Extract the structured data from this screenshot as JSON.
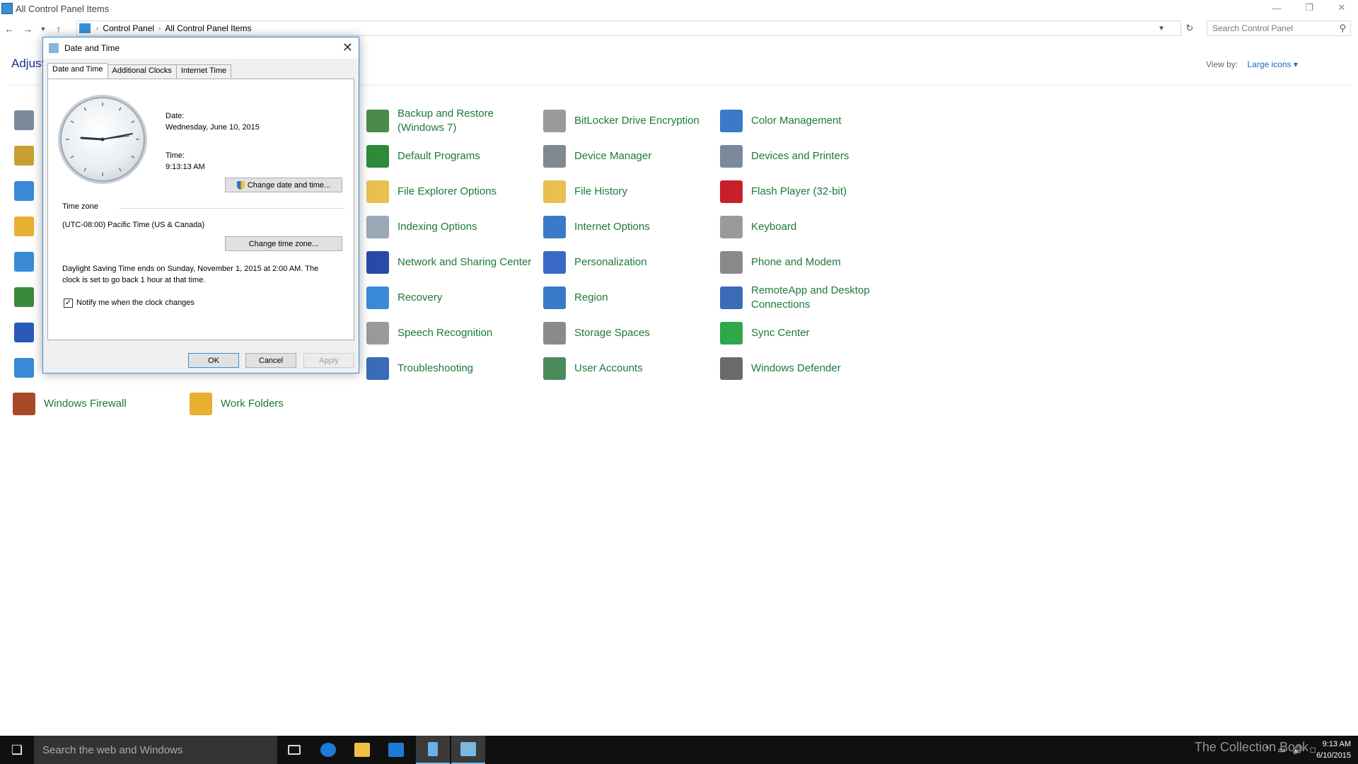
{
  "window": {
    "title": "All Control Panel Items"
  },
  "address": {
    "crumbs": [
      "Control Panel",
      "All Control Panel Items"
    ],
    "search_placeholder": "Search Control Panel"
  },
  "header": {
    "adjust_partial": "Adjust",
    "view_by_label": "View by:",
    "view_by_value": "Large icons"
  },
  "items": [
    {
      "label": "Backup and Restore (Windows 7)",
      "color": "#4a8a4a"
    },
    {
      "label": "BitLocker Drive Encryption",
      "color": "#9a9a9a"
    },
    {
      "label": "Color Management",
      "color": "#3a7ac8"
    },
    {
      "label": "Default Programs",
      "color": "#2c8a3a"
    },
    {
      "label": "Device Manager",
      "color": "#808890"
    },
    {
      "label": "Devices and Printers",
      "color": "#7a8a9a"
    },
    {
      "label": "File Explorer Options",
      "color": "#e8c050"
    },
    {
      "label": "File History",
      "color": "#e8c050"
    },
    {
      "label": "Flash Player (32-bit)",
      "color": "#c8202a"
    },
    {
      "label": "Indexing Options",
      "color": "#9aa8b8"
    },
    {
      "label": "Internet Options",
      "color": "#3a7ac8"
    },
    {
      "label": "Keyboard",
      "color": "#9a9a9a"
    },
    {
      "label": "Network and Sharing Center",
      "color": "#2a4aa8"
    },
    {
      "label": "Personalization",
      "color": "#3a6ac8"
    },
    {
      "label": "Phone and Modem",
      "color": "#8a8a8a"
    },
    {
      "label": "Recovery",
      "color": "#3a8ad8"
    },
    {
      "label": "Region",
      "color": "#3a7ac8"
    },
    {
      "label": "RemoteApp and Desktop Connections",
      "color": "#3a6ab8"
    },
    {
      "label": "Speech Recognition",
      "color": "#9a9a9a"
    },
    {
      "label": "Storage Spaces",
      "color": "#8a8a8a"
    },
    {
      "label": "Sync Center",
      "color": "#2ea84a"
    },
    {
      "label": "Troubleshooting",
      "color": "#3a6ab8"
    },
    {
      "label": "User Accounts",
      "color": "#4a8a5a"
    },
    {
      "label": "Windows Defender",
      "color": "#6a6a6a"
    },
    {
      "label": "Windows Firewall",
      "color": "#a84a2a"
    },
    {
      "label": "Work Folders",
      "color": "#e8b030"
    }
  ],
  "left_icons": [
    "#7a8a9a",
    "#c8a030",
    "#3a8ad8",
    "#e8b030",
    "#3a8ad8",
    "#3a8a3a",
    "#2a5ab8",
    "#3a8ad8"
  ],
  "dialog": {
    "title": "Date and Time",
    "tabs": [
      "Date and Time",
      "Additional Clocks",
      "Internet Time"
    ],
    "date_label": "Date:",
    "date_value": "Wednesday, June 10, 2015",
    "time_label": "Time:",
    "time_value": "9:13:13 AM",
    "change_datetime": "Change date and time...",
    "timezone_label": "Time zone",
    "timezone_value": "(UTC-08:00) Pacific Time (US & Canada)",
    "change_timezone": "Change time zone...",
    "dst_line1": "Daylight Saving Time ends on Sunday, November 1, 2015 at 2:00 AM. The",
    "dst_line2": "clock is set to go back 1 hour at that time.",
    "notify": "Notify me when the clock changes",
    "notify_checked": true,
    "ok": "OK",
    "cancel": "Cancel",
    "apply": "Apply"
  },
  "taskbar": {
    "search_placeholder": "Search the web and Windows",
    "clock_time": "9:13 AM",
    "clock_date": "6/10/2015",
    "watermark": "The Collection Book",
    "pinned": [
      "task-view",
      "edge",
      "file-explorer",
      "store",
      "notepad",
      "control-panel"
    ]
  }
}
